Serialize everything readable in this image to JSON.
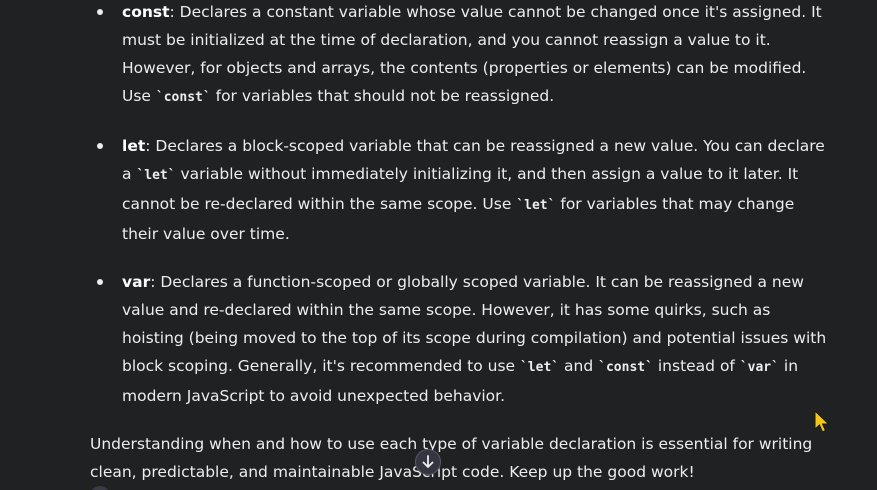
{
  "bullets": [
    {
      "keyword": "const",
      "parts": [
        {
          "t": "text",
          "v": ": Declares a constant variable whose value cannot be changed once it's assigned. It must be initialized at the time of declaration, and you cannot reassign a value to it. However, for objects and arrays, the contents (properties or elements) can be modified. Use "
        },
        {
          "t": "code",
          "v": "`const`"
        },
        {
          "t": "text",
          "v": " for variables that should not be reassigned."
        }
      ]
    },
    {
      "keyword": "let",
      "parts": [
        {
          "t": "text",
          "v": ": Declares a block-scoped variable that can be reassigned a new value. You can declare a "
        },
        {
          "t": "code",
          "v": "`let`"
        },
        {
          "t": "text",
          "v": " variable without immediately initializing it, and then assign a value to it later. It cannot be re-declared within the same scope. Use "
        },
        {
          "t": "code",
          "v": "`let`"
        },
        {
          "t": "text",
          "v": " for variables that may change their value over time."
        }
      ]
    },
    {
      "keyword": "var",
      "parts": [
        {
          "t": "text",
          "v": ": Declares a function-scoped or globally scoped variable. It can be reassigned a new value and re-declared within the same scope. However, it has some quirks, such as hoisting (being moved to the top of its scope during compilation) and potential issues with block scoping. Generally, it's recommended to use "
        },
        {
          "t": "code",
          "v": "`let`"
        },
        {
          "t": "text",
          "v": " and "
        },
        {
          "t": "code",
          "v": "`const`"
        },
        {
          "t": "text",
          "v": " instead of "
        },
        {
          "t": "code",
          "v": "`var`"
        },
        {
          "t": "text",
          "v": " in modern JavaScript to avoid unexpected behavior."
        }
      ]
    }
  ],
  "summary": "Understanding when and how to use each type of variable declaration is essential for writing clean, predictable, and maintainable JavaScript code. Keep up the good work!",
  "icons": {
    "scroll_down": "arrow-down-icon",
    "cursor": "pointer-cursor-icon"
  },
  "colors": {
    "background": "#202123",
    "text": "#ececf1",
    "cursor": "#f5c518"
  }
}
